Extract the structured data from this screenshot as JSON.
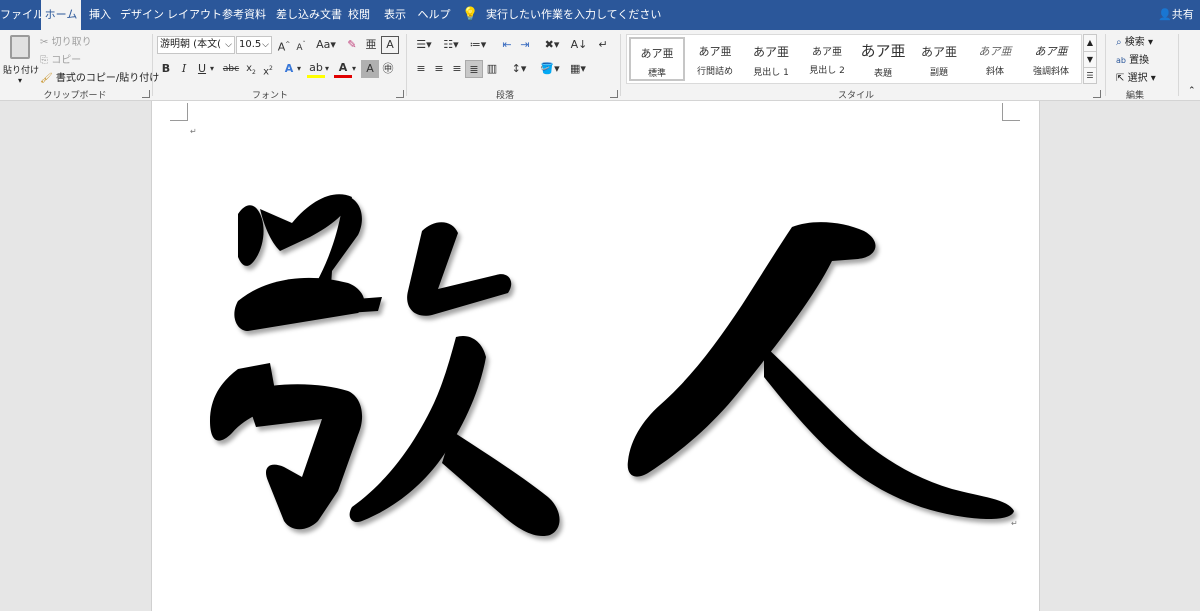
{
  "menu": {
    "tabs": [
      "ファイル",
      "ホーム",
      "挿入",
      "デザイン",
      "レイアウト",
      "参考資料",
      "差し込み文書",
      "校閲",
      "表示",
      "ヘルプ"
    ],
    "active_tab": "ホーム",
    "tell_me": "実行したい作業を入力してください",
    "share": "共有"
  },
  "clipboard": {
    "paste": "貼り付け",
    "cut": "切り取り",
    "copy": "コピー",
    "format_painter": "書式のコピー/貼り付け",
    "label": "クリップボード"
  },
  "font": {
    "name": "游明朝 (本文(",
    "size": "10.5",
    "label": "フォント"
  },
  "paragraph": {
    "label": "段落"
  },
  "styles": {
    "items": [
      {
        "sample": "あア亜",
        "name": "標準"
      },
      {
        "sample": "あア亜",
        "name": "行間詰め"
      },
      {
        "sample": "あア亜",
        "name": "見出し 1"
      },
      {
        "sample": "あア亜",
        "name": "見出し 2"
      },
      {
        "sample": "あア亜",
        "name": "表題"
      },
      {
        "sample": "あア亜",
        "name": "副題"
      },
      {
        "sample": "あア亜",
        "name": "斜体"
      },
      {
        "sample": "あア亜",
        "name": "強調斜体"
      }
    ],
    "label": "スタイル"
  },
  "editing": {
    "find": "検索",
    "replace": "置換",
    "select": "選択",
    "label": "編集"
  },
  "document": {
    "text": "敬 人"
  },
  "colors": {
    "accent": "#2b579a",
    "ribbon_bg": "#f3f3f3",
    "doc_bg": "#e6e6e6"
  }
}
